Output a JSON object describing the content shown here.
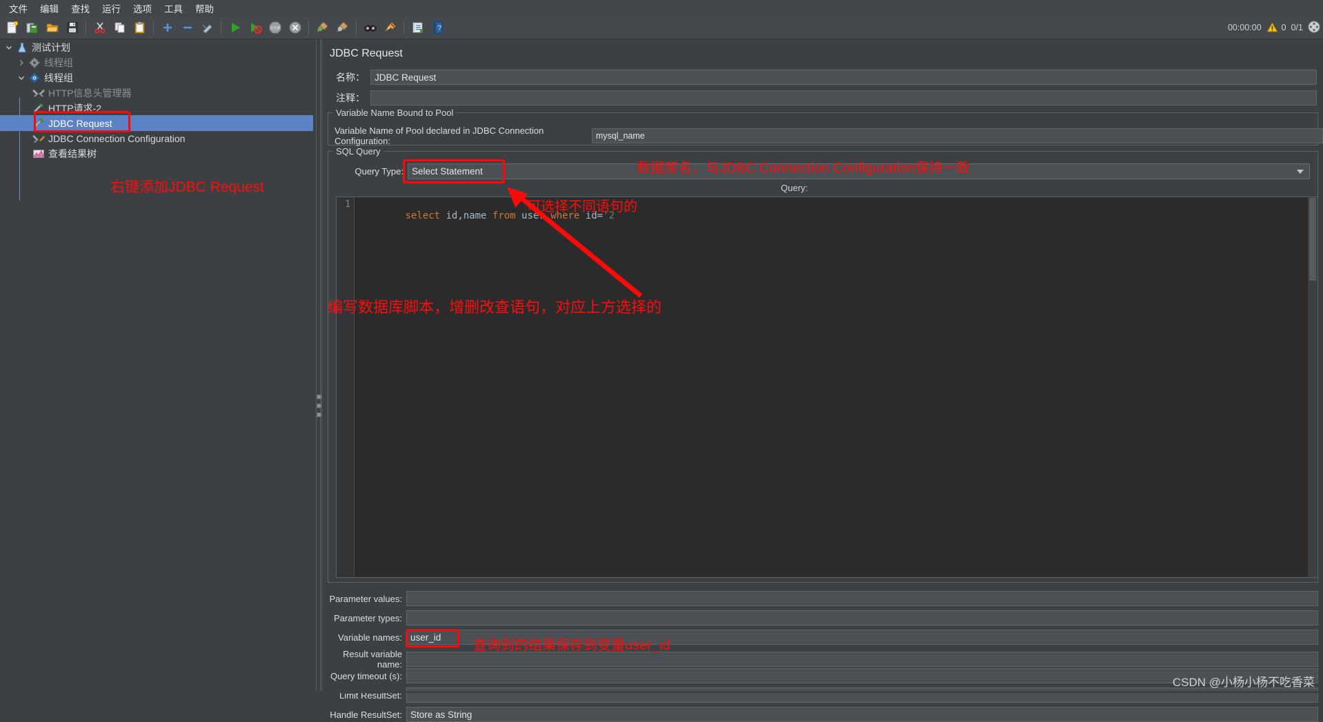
{
  "menu": {
    "items": [
      "文件",
      "编辑",
      "查找",
      "运行",
      "选项",
      "工具",
      "帮助"
    ]
  },
  "toolbar": {
    "buttons": [
      {
        "name": "new-icon",
        "title": "新建"
      },
      {
        "name": "templates-icon",
        "title": "模板"
      },
      {
        "name": "open-icon",
        "title": "打开"
      },
      {
        "name": "save-icon",
        "title": "保存"
      },
      {
        "name": "cut-icon",
        "title": "剪切"
      },
      {
        "name": "copy-icon",
        "title": "复制"
      },
      {
        "name": "paste-icon",
        "title": "粘贴"
      },
      {
        "name": "expand-all-icon",
        "title": "展开全部"
      },
      {
        "name": "collapse-all-icon",
        "title": "收起全部"
      },
      {
        "name": "toggle-icon",
        "title": "启用/禁用"
      },
      {
        "name": "start-icon",
        "title": "启动"
      },
      {
        "name": "start-no-pause-icon",
        "title": "无间断启动"
      },
      {
        "name": "stop-icon",
        "title": "停止"
      },
      {
        "name": "shutdown-icon",
        "title": "关闭"
      },
      {
        "name": "clear-icon",
        "title": "清除"
      },
      {
        "name": "clear-all-icon",
        "title": "清除全部"
      },
      {
        "name": "search-icon",
        "title": "搜索"
      },
      {
        "name": "reset-search-icon",
        "title": "重置搜索"
      },
      {
        "name": "function-helper-icon",
        "title": "函数助手"
      },
      {
        "name": "help-icon",
        "title": "帮助"
      }
    ]
  },
  "status": {
    "elapsed": "00:00:00",
    "warnings": "0",
    "threads": "0/1"
  },
  "tree": {
    "nodes": [
      {
        "label": "测试计划",
        "icon": "test-plan-icon",
        "depth": 0,
        "twisty": "open",
        "dim": false,
        "selected": false
      },
      {
        "label": "线程组",
        "icon": "thread-group-disabled-icon",
        "depth": 1,
        "twisty": "closed",
        "dim": true,
        "selected": false
      },
      {
        "label": "线程组",
        "icon": "thread-group-icon",
        "depth": 1,
        "twisty": "open",
        "dim": false,
        "selected": false
      },
      {
        "label": "HTTP信息头管理器",
        "icon": "header-manager-icon",
        "depth": 2,
        "twisty": "none",
        "dim": true,
        "selected": false
      },
      {
        "label": "HTTP请求-2",
        "icon": "http-request-icon",
        "depth": 2,
        "twisty": "none",
        "dim": false,
        "selected": false
      },
      {
        "label": "JDBC Request",
        "icon": "jdbc-request-icon",
        "depth": 2,
        "twisty": "none",
        "dim": false,
        "selected": true
      },
      {
        "label": "JDBC Connection Configuration",
        "icon": "jdbc-connection-config-icon",
        "depth": 2,
        "twisty": "none",
        "dim": false,
        "selected": false
      },
      {
        "label": "查看结果树",
        "icon": "view-results-tree-icon",
        "depth": 2,
        "twisty": "none",
        "dim": false,
        "selected": false
      }
    ]
  },
  "pane": {
    "title": "JDBC Request",
    "name_label": "名称：",
    "name_value": "JDBC Request",
    "comment_label": "注释：",
    "comment_value": "",
    "pool_group_title": "Variable Name Bound to Pool",
    "pool_label": "Variable Name of Pool declared in JDBC Connection Configuration:",
    "pool_value": "mysql_name",
    "sql_group_title": "SQL Query",
    "query_type_label": "Query Type:",
    "query_type_value": "Select Statement",
    "query_label": "Query:",
    "sql_line_number": "1",
    "sql_tokens": [
      {
        "text": "select ",
        "cls": "kw"
      },
      {
        "text": "id,name ",
        "cls": "id"
      },
      {
        "text": "from ",
        "cls": "kw"
      },
      {
        "text": "user ",
        "cls": "id"
      },
      {
        "text": "where ",
        "cls": "kw"
      },
      {
        "text": "id=",
        "cls": "id"
      },
      {
        "text": "'2",
        "cls": "str"
      }
    ],
    "fields": [
      {
        "label": "Parameter values:",
        "value": ""
      },
      {
        "label": "Parameter types:",
        "value": ""
      },
      {
        "label": "Variable names:",
        "value": "user_id"
      },
      {
        "label": "Result variable name:",
        "value": ""
      },
      {
        "label": "Query timeout (s):",
        "value": ""
      },
      {
        "label": "Limit ResultSet:",
        "value": ""
      },
      {
        "label": "Handle ResultSet:",
        "value": "Store as String"
      }
    ]
  },
  "annotations": {
    "tree_note": "右键添加JDBC Request",
    "pool_note": "数据库名，与JDBC Connection Configuration保持一致",
    "query_type_note": "可选择不同语句的",
    "editor_note": "编写数据库脚本，增删改查语句，对应上方选择的",
    "variable_note": "查询到的结果保存到变量user_id",
    "color": "#fd0d0d"
  },
  "watermark": "CSDN @小杨小杨不吃香菜"
}
